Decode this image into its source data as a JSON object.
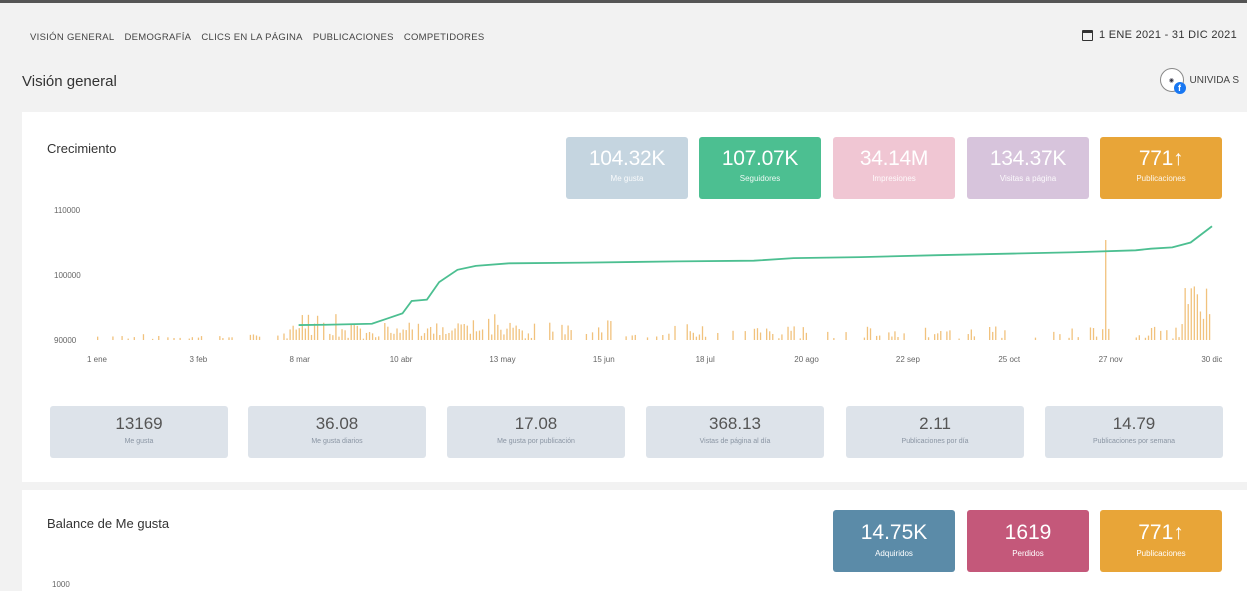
{
  "nav": {
    "items": [
      "VISIÓN GENERAL",
      "DEMOGRAFÍA",
      "CLICS EN LA PÁGINA",
      "PUBLICACIONES",
      "COMPETIDORES"
    ],
    "date_range": "1 ENE 2021 - 31 DIC 2021"
  },
  "page": {
    "title": "Visión general",
    "account_name": "UNIVIDA S"
  },
  "growth": {
    "title": "Crecimiento",
    "kpis": [
      {
        "value": "104.32K",
        "label": "Me gusta",
        "color": "#c5d5e0"
      },
      {
        "value": "107.07K",
        "label": "Seguidores",
        "color": "#4cbf91"
      },
      {
        "value": "34.14M",
        "label": "Impresiones",
        "color": "#f0c6d3"
      },
      {
        "value": "134.37K",
        "label": "Visitas a página",
        "color": "#d7c4dc"
      },
      {
        "value": "771↑",
        "label": "Publicaciones",
        "color": "#e8a538"
      }
    ],
    "stats": [
      {
        "value": "13169",
        "label": "Me gusta"
      },
      {
        "value": "36.08",
        "label": "Me gusta diarios"
      },
      {
        "value": "17.08",
        "label": "Me gusta por publicación"
      },
      {
        "value": "368.13",
        "label": "Vistas de página al día"
      },
      {
        "value": "2.11",
        "label": "Publicaciones por día"
      },
      {
        "value": "14.79",
        "label": "Publicaciones por semana"
      }
    ]
  },
  "balance": {
    "title": "Balance de Me gusta",
    "kpis": [
      {
        "value": "14.75K",
        "label": "Adquiridos",
        "color": "#5b8ba8"
      },
      {
        "value": "1619",
        "label": "Perdidos",
        "color": "#c4587a"
      },
      {
        "value": "771↑",
        "label": "Publicaciones",
        "color": "#e8a538"
      }
    ],
    "y_tick": "1000"
  },
  "chart_data": {
    "type": "line",
    "title": "",
    "xlabel": "",
    "ylabel": "",
    "ylim": [
      90000,
      110000
    ],
    "y_ticks": [
      "90000",
      "100000",
      "110000"
    ],
    "x_ticks": [
      "1 ene",
      "3 feb",
      "8 mar",
      "10 abr",
      "13 may",
      "15 jun",
      "18 jul",
      "20 ago",
      "22 sep",
      "25 oct",
      "27 nov",
      "30 dic"
    ],
    "series": [
      {
        "color": "#4cbf91",
        "points": [
          [
            66,
            92300
          ],
          [
            75,
            92350
          ],
          [
            90,
            92500
          ],
          [
            95,
            93300
          ],
          [
            100,
            94100
          ],
          [
            103,
            96000
          ],
          [
            108,
            96200
          ],
          [
            112,
            98900
          ],
          [
            118,
            100800
          ],
          [
            124,
            101400
          ],
          [
            135,
            101800
          ],
          [
            160,
            101900
          ],
          [
            190,
            102100
          ],
          [
            215,
            102200
          ],
          [
            228,
            102600
          ],
          [
            250,
            102750
          ],
          [
            275,
            103050
          ],
          [
            300,
            103300
          ],
          [
            320,
            103500
          ],
          [
            340,
            103800
          ],
          [
            345,
            104050
          ],
          [
            352,
            104250
          ],
          [
            358,
            105000
          ],
          [
            365,
            107500
          ]
        ]
      }
    ],
    "bars_color": "#f1c27d",
    "bars_note": "daily posts/interactions background bars"
  }
}
